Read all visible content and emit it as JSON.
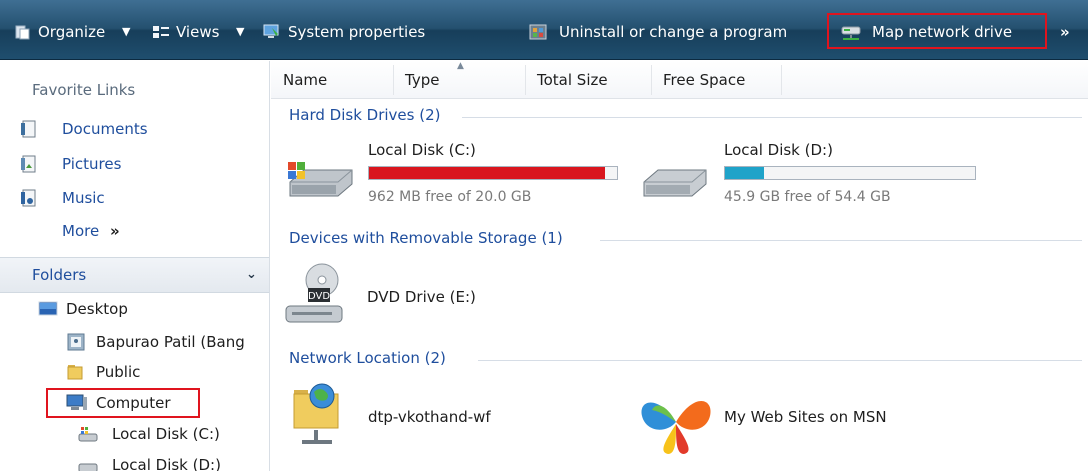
{
  "toolbar": {
    "organize": "Organize",
    "views": "Views",
    "system_properties": "System properties",
    "uninstall": "Uninstall or change a program",
    "map_network_drive": "Map network drive",
    "more": "»"
  },
  "sidebar": {
    "favorite_links_title": "Favorite Links",
    "favorites": [
      {
        "label": "Documents",
        "icon": "documents-icon"
      },
      {
        "label": "Pictures",
        "icon": "pictures-icon"
      },
      {
        "label": "Music",
        "icon": "music-icon"
      }
    ],
    "more_label": "More",
    "more_chevron": "»",
    "folders_title": "Folders",
    "tree": [
      {
        "label": "Desktop",
        "icon": "desktop-icon"
      },
      {
        "label": "Bapurao Patil (Bang",
        "icon": "user-folder-icon"
      },
      {
        "label": "Public",
        "icon": "folder-icon"
      },
      {
        "label": "Computer",
        "icon": "computer-icon"
      },
      {
        "label": "Local Disk (C:)",
        "icon": "system-drive-icon"
      },
      {
        "label": "Local Disk (D:)",
        "icon": "drive-icon"
      }
    ]
  },
  "columns": [
    "Name",
    "Type",
    "Total Size",
    "Free Space"
  ],
  "groups": {
    "hard_disks": {
      "title": "Hard Disk Drives (2)",
      "items": [
        {
          "name": "Local Disk (C:)",
          "free_text": "962 MB free of 20.0 GB",
          "used_fraction": 0.953,
          "bar_color": "#d9161e"
        },
        {
          "name": "Local Disk (D:)",
          "free_text": "45.9 GB free of 54.4 GB",
          "used_fraction": 0.156,
          "bar_color": "#1fa3c9"
        }
      ]
    },
    "removable": {
      "title": "Devices with Removable Storage (1)",
      "items": [
        {
          "name": "DVD Drive (E:)",
          "icon_text": "DVD"
        }
      ]
    },
    "network": {
      "title": "Network Location (2)",
      "items": [
        {
          "name": "dtp-vkothand-wf"
        },
        {
          "name": "My Web Sites on MSN"
        }
      ]
    }
  },
  "colors": {
    "highlight": "#e0141e",
    "link": "#1f4e9d"
  }
}
